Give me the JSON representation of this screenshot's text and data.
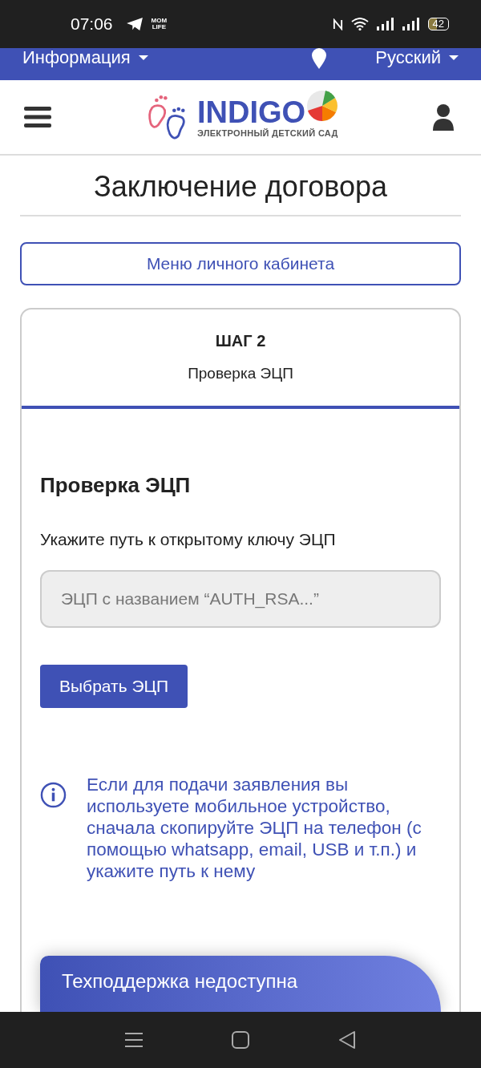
{
  "status_bar": {
    "time": "07:06",
    "app_badge": [
      "MOM",
      "LIFE"
    ],
    "battery": "42"
  },
  "top_bar": {
    "info_menu": "Информация",
    "language": "Русский"
  },
  "header": {
    "logo_title": "INDIGO",
    "logo_subtitle": "ЭЛЕКТРОННЫЙ ДЕТСКИЙ САД"
  },
  "page_title": "Заключение договора",
  "menu_button": "Меню личного кабинета",
  "step": {
    "label": "ШАГ 2",
    "name": "Проверка ЭЦП"
  },
  "form": {
    "heading": "Проверка ЭЦП",
    "field_label": "Укажите путь к открытому ключу ЭЦП",
    "placeholder": "ЭЦП с названием “AUTH_RSA...”",
    "button": "Выбрать ЭЦП",
    "note": "Если для подачи заявления вы используете мобильное устройство, сначала скопируйте ЭЦП на телефон (с помощью whatsapp, email, USB и т.п.) и укажите путь к нему"
  },
  "support_banner": "Техподдержка недоступна"
}
